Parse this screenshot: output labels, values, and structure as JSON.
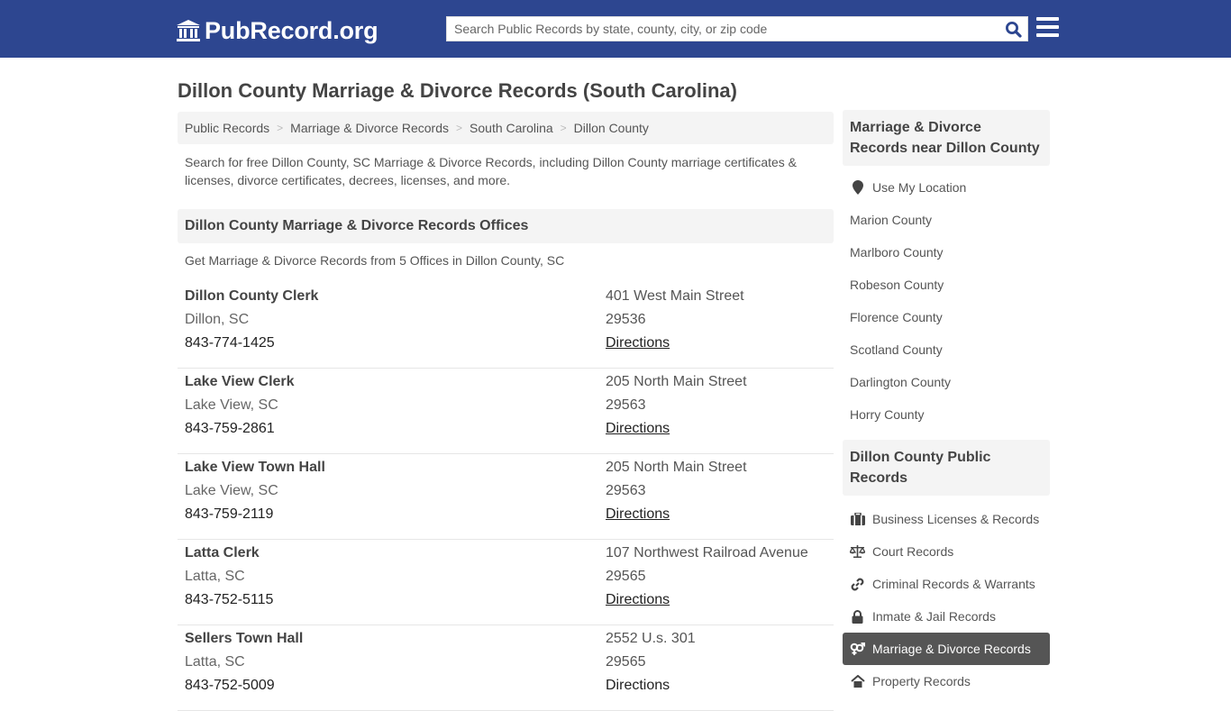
{
  "header": {
    "logo_text": "PubRecord.org",
    "search_placeholder": "Search Public Records by state, county, city, or zip code",
    "colors": {
      "bar": "#2d4690",
      "search_icon": "#2d4690"
    }
  },
  "page": {
    "title": "Dillon County Marriage & Divorce Records (South Carolina)",
    "breadcrumbs": [
      "Public Records",
      "Marriage & Divorce Records",
      "South Carolina",
      "Dillon County"
    ],
    "intro": "Search for free Dillon County, SC Marriage & Divorce Records, including Dillon County marriage certificates & licenses, divorce certificates, decrees, licenses, and more.",
    "section_title": "Dillon County Marriage & Divorce Records Offices",
    "section_sub": "Get Marriage & Divorce Records from 5 Offices in Dillon County, SC"
  },
  "offices": [
    {
      "name": "Dillon County Clerk",
      "city": "Dillon, SC",
      "phone": "843-774-1425",
      "address": "401 West Main Street",
      "zip": "29536",
      "directions": "Directions"
    },
    {
      "name": "Lake View Clerk",
      "city": "Lake View, SC",
      "phone": "843-759-2861",
      "address": "205 North Main Street",
      "zip": "29563",
      "directions": "Directions"
    },
    {
      "name": "Lake View Town Hall",
      "city": "Lake View, SC",
      "phone": "843-759-2119",
      "address": "205 North Main Street",
      "zip": "29563",
      "directions": "Directions"
    },
    {
      "name": "Latta Clerk",
      "city": "Latta, SC",
      "phone": "843-752-5115",
      "address": "107 Northwest Railroad Avenue",
      "zip": "29565",
      "directions": "Directions"
    },
    {
      "name": "Sellers Town Hall",
      "city": "Latta, SC",
      "phone": "843-752-5009",
      "address": "2552 U.s. 301",
      "zip": "29565",
      "directions": "Directions"
    }
  ],
  "sidebar": {
    "nearby_title": "Marriage & Divorce Records near Dillon County",
    "use_location": {
      "label": "Use My Location",
      "icon": "map-marker-icon"
    },
    "nearby": [
      "Marion County",
      "Marlboro County",
      "Robeson County",
      "Florence County",
      "Scotland County",
      "Darlington County",
      "Horry County"
    ],
    "public_title": "Dillon County Public Records",
    "public_records": [
      {
        "label": "Business Licenses & Records",
        "icon": "briefcase-icon",
        "active": false
      },
      {
        "label": "Court Records",
        "icon": "scales-icon",
        "active": false
      },
      {
        "label": "Criminal Records & Warrants",
        "icon": "link-icon",
        "active": false
      },
      {
        "label": "Inmate & Jail Records",
        "icon": "lock-icon",
        "active": false
      },
      {
        "label": "Marriage & Divorce Records",
        "icon": "venus-mars-icon",
        "active": true
      },
      {
        "label": "Property Records",
        "icon": "house-icon",
        "active": false
      }
    ]
  }
}
